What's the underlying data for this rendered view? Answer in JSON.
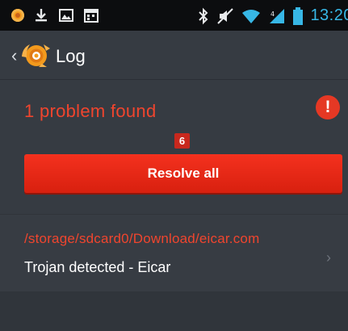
{
  "status_bar": {
    "left_icons": [
      "avast-notification-icon",
      "download-icon",
      "image-icon",
      "calendar-icon"
    ],
    "right_icons": [
      "bluetooth-icon",
      "mute-icon",
      "wifi-icon",
      "signal-icon",
      "battery-icon"
    ],
    "time": "13:20"
  },
  "action_bar": {
    "back_glyph": "‹",
    "title": "Log"
  },
  "log": {
    "summary": "1 problem found",
    "alert_glyph": "!",
    "step_badge": "6",
    "resolve_label": "Resolve all",
    "items": [
      {
        "path": "/storage/sdcard0/Download/eicar.com",
        "description": "Trojan detected - Eicar",
        "chevron": "›"
      }
    ]
  },
  "colors": {
    "accent_red": "#f0452e",
    "button_red": "#e62a17",
    "status_time": "#37b7e6",
    "background": "#363b42"
  }
}
